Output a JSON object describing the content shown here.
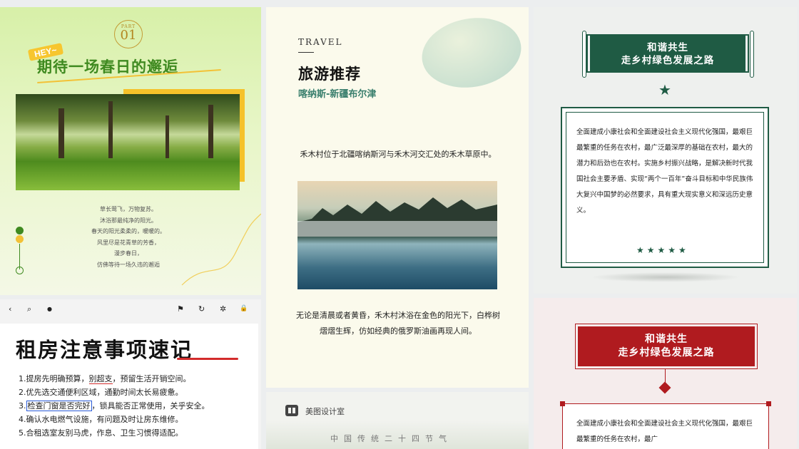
{
  "spring": {
    "part_label": "PART",
    "part_number": "01",
    "hey": "HEY~",
    "title": "期待一场春日的邂逅",
    "poem": [
      "草长莺飞，万物复苏。",
      "沐浴那最纯净的阳光。",
      "春天的阳光柔柔的，暖暖的。",
      "风里尽是花青草的芳香，",
      "漫步春日，",
      "仿佛等待一场久违的邂逅"
    ]
  },
  "rental": {
    "toolbar": {
      "back": "‹",
      "search": "⌕",
      "bell": "●",
      "flag": "⚑",
      "refresh": "↻",
      "settings": "✲",
      "lock": "🔒"
    },
    "title_main": "租房注意事项",
    "title_accent": "速记",
    "items": [
      {
        "pre": "1.提房先明确预算，",
        "mark": "别超支",
        "post": "，预留生活开销空间。"
      },
      {
        "pre": "2.优先选交通便利区域，通勤时间太长易疲惫。",
        "mark": "",
        "post": ""
      },
      {
        "pre": "3.",
        "mark": "检查门窗是否完好",
        "post": "，锁具能否正常使用，关乎安全。"
      },
      {
        "pre": "4.确认水电燃气设施，有问题及时让房东维修。",
        "mark": "",
        "post": ""
      },
      {
        "pre": "5.合租选室友别马虎，作息、卫生习惯得适配。",
        "mark": "",
        "post": ""
      }
    ]
  },
  "travel": {
    "tag": "TRAVEL",
    "title": "旅游推荐",
    "subtitle": "喀纳斯-新疆布尔津",
    "p1": "禾木村位于北疆喀纳斯河与禾木河交汇处的禾木草原中。",
    "p2": "无论是清晨或者黄昏，禾木村沐浴在金色的阳光下，白桦树熠熠生辉，仿如经典的俄罗斯油画再现人间。"
  },
  "meitu": {
    "brand": "美图设计室",
    "subtitle": "中国传统二十四节气"
  },
  "green": {
    "banner_line1": "和谐共生",
    "banner_line2": "走乡村绿色发展之路",
    "star": "★",
    "body": "全面建成小康社会和全面建设社会主义现代化强国，最艰巨最繁重的任务在农村，最广泛最深厚的基础在农村，最大的潜力和后劲也在农村。实施乡村振兴战略，是解决新时代我国社会主要矛盾、实现“两个一百年”奋斗目标和中华民族伟大复兴中国梦的必然要求，具有重大现实意义和深远历史意义。",
    "stars": "★★★★★"
  },
  "red": {
    "banner_line1": "和谐共生",
    "banner_line2": "走乡村绿色发展之路",
    "body": "全面建成小康社会和全面建设社会主义现代化强国，最艰巨最繁重的任务在农村，最广"
  },
  "colors": {
    "green": "#1f5b44",
    "red": "#b01b1f",
    "spring_green": "#3f8a20",
    "yellow": "#f3c136"
  }
}
